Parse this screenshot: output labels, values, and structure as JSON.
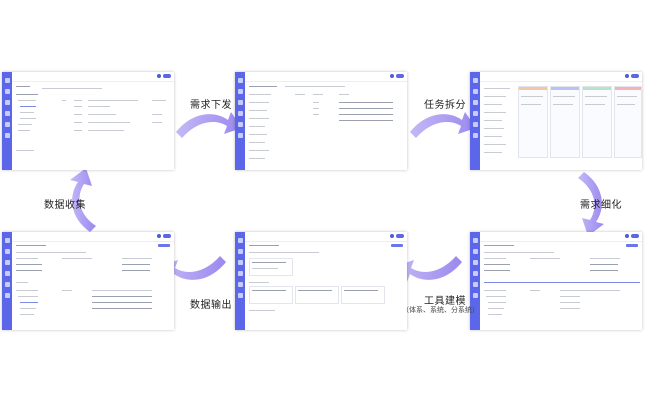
{
  "steps": {
    "demand_issue": "需求下发",
    "task_split": "任务拆分",
    "demand_refine": "需求细化",
    "tool_modeling": "工具建模",
    "tool_modeling_sub": "（体系、系统、分系统）",
    "data_output": "数据输出",
    "data_collect": "数据收集"
  },
  "colors": {
    "arrow": "#a99af0",
    "accent": "#5b67e8"
  }
}
